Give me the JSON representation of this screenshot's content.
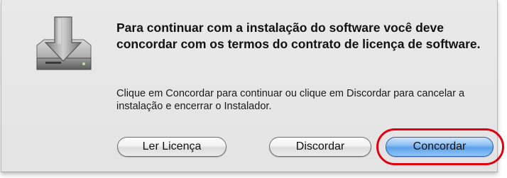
{
  "dialog": {
    "title": "Para continuar com a instalação do software você deve concordar com os termos do contrato de licença de software.",
    "message": "Clique em Concordar para continuar ou clique em Discordar para cancelar a instalação e encerrar o Instalador.",
    "icon": "installer-disk-icon"
  },
  "buttons": {
    "license_label": "Ler Licença",
    "disagree_label": "Discordar",
    "agree_label": "Concordar"
  },
  "colors": {
    "highlight": "#e00010",
    "default_button": "#5ea2ea",
    "sheet_background": "#e6e6e6"
  }
}
